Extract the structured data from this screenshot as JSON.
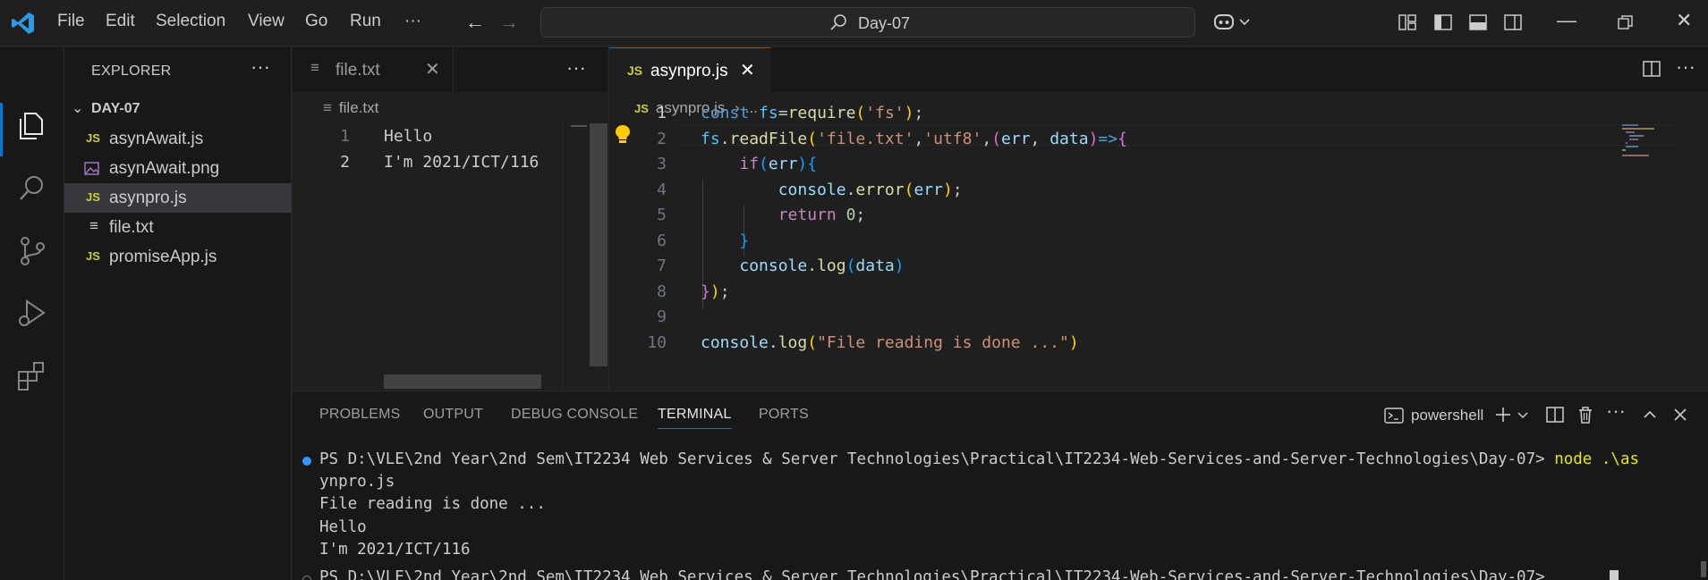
{
  "titlebar": {
    "menu": [
      "File",
      "Edit",
      "Selection",
      "View",
      "Go",
      "Run",
      "···"
    ],
    "command_center_label": "Day-07"
  },
  "sidebar": {
    "title": "EXPLORER",
    "more": "···",
    "folder": "DAY-07",
    "files": [
      {
        "name": "asynAwait.js",
        "icon": "js-file-icon",
        "icon_text": "JS"
      },
      {
        "name": "asynAwait.png",
        "icon": "image-file-icon",
        "icon_text": ""
      },
      {
        "name": "asynpro.js",
        "icon": "js-file-icon",
        "icon_text": "JS",
        "selected": true
      },
      {
        "name": "file.txt",
        "icon": "text-file-icon",
        "icon_text": "≡"
      },
      {
        "name": "promiseApp.js",
        "icon": "js-file-icon",
        "icon_text": "JS"
      }
    ]
  },
  "editor_left": {
    "tab_label": "file.txt",
    "tab_icon": "≡",
    "tab_close": "✕",
    "more": "···",
    "breadcrumb": "file.txt",
    "line_numbers": [
      "1",
      "2"
    ],
    "lines": [
      "Hello",
      "I'm 2021/ICT/116"
    ]
  },
  "editor_right": {
    "tab_label": "asynpro.js",
    "tab_icon": "JS",
    "tab_close": "✕",
    "more": "···",
    "breadcrumb_file": "asynpro.js",
    "breadcrumb_sep": "›",
    "breadcrumb_rest": "...",
    "line_numbers": [
      "1",
      "2",
      "3",
      "4",
      "5",
      "6",
      "7",
      "8",
      "9",
      "10"
    ]
  },
  "panel": {
    "tabs": [
      "PROBLEMS",
      "OUTPUT",
      "DEBUG CONSOLE",
      "TERMINAL",
      "PORTS"
    ],
    "active_tab": "TERMINAL",
    "shell": "powershell",
    "terminal": {
      "prompt1": "PS D:\\VLE\\2nd Year\\2nd Sem\\IT2234 Web Services & Server Technologies\\Practical\\IT2234-Web-Services-and-Server-Technologies\\Day-07> ",
      "cmd1": "node .\\as",
      "cont1": "ynpro.js",
      "out1": "File reading is done ...",
      "out2": "Hello",
      "out3": "I'm 2021/ICT/116",
      "prompt2": "PS D:\\VLE\\2nd Year\\2nd Sem\\IT2234 Web Services & Server Technologies\\Practical\\IT2234-Web-Services-and-Server-Technologies\\Day-07> "
    }
  },
  "colors": {
    "accent": "#0078d4",
    "js_icon": "#cbcb41",
    "terminal_dot": "#3794ff",
    "terminal_command": "#e5e510"
  }
}
